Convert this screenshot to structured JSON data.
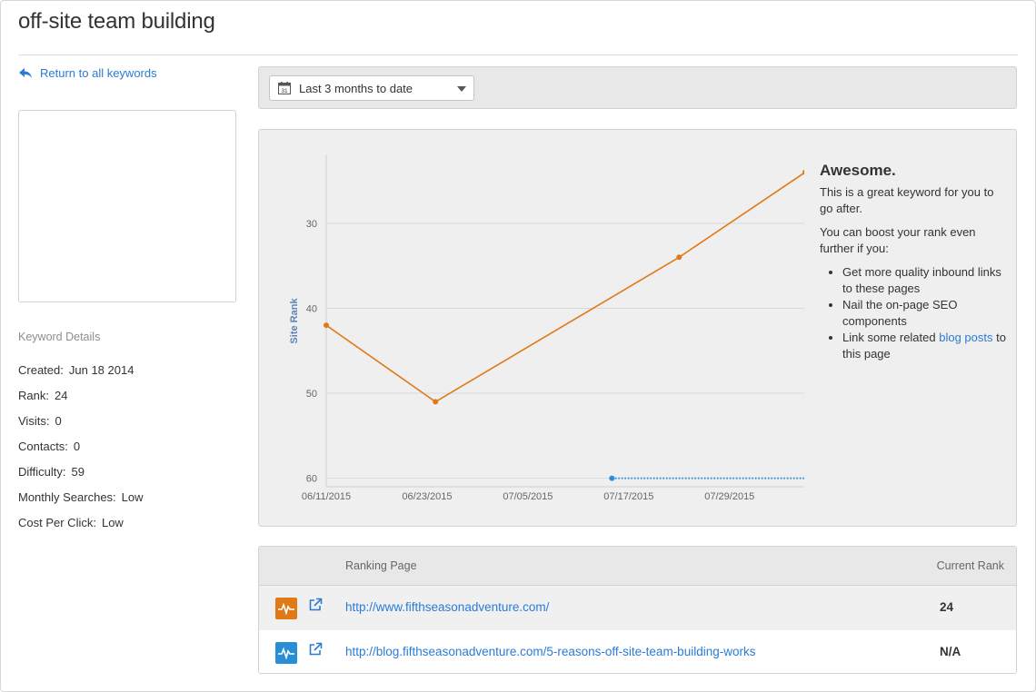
{
  "page": {
    "title": "off-site team building"
  },
  "sidebar": {
    "back_link": "Return to all keywords",
    "details_heading": "Keyword Details",
    "details": [
      {
        "label": "Created:",
        "value": "Jun 18 2014"
      },
      {
        "label": "Rank:",
        "value": "24"
      },
      {
        "label": "Visits:",
        "value": "0"
      },
      {
        "label": "Contacts:",
        "value": "0"
      },
      {
        "label": "Difficulty:",
        "value": "59"
      },
      {
        "label": "Monthly Searches:",
        "value": "Low"
      },
      {
        "label": "Cost Per Click:",
        "value": "Low"
      }
    ]
  },
  "toolbar": {
    "date_range": "Last 3 months to date",
    "calendar_icon": "calendar-icon",
    "calendar_day": "31"
  },
  "advice": {
    "heading": "Awesome.",
    "line1": "This is a great keyword for you to go after.",
    "line2": "You can boost your rank even further if you:",
    "bullets": [
      "Get more quality inbound links to these pages",
      "Nail the on-page SEO components"
    ],
    "bullet3_prefix": "Link some related ",
    "bullet3_link": "blog posts",
    "bullet3_suffix": " to this page"
  },
  "table": {
    "col_page": "Ranking Page",
    "col_rank": "Current Rank",
    "rows": [
      {
        "url": "http://www.fifthseasonadventure.com/",
        "rank": "24",
        "badge_color": "#e07a17"
      },
      {
        "url": "http://blog.fifthseasonadventure.com/5-reasons-off-site-team-building-works",
        "rank": "N/A",
        "badge_color": "#2a8ed6"
      }
    ]
  },
  "chart_data": {
    "type": "line",
    "ylabel": "Site Rank",
    "y_reversed": true,
    "ylim": [
      22,
      61
    ],
    "yticks": [
      30,
      40,
      50,
      60
    ],
    "xlim": [
      "2015-06-11",
      "2015-08-07"
    ],
    "xtick_labels": [
      "06/11/2015",
      "06/23/2015",
      "07/05/2015",
      "07/17/2015",
      "07/29/2015"
    ],
    "series": [
      {
        "style": "solid",
        "color": "#e07a17",
        "points": [
          {
            "x": "2015-06-11",
            "y": 42
          },
          {
            "x": "2015-06-24",
            "y": 51
          },
          {
            "x": "2015-07-23",
            "y": 34
          },
          {
            "x": "2015-08-07",
            "y": 24
          }
        ]
      },
      {
        "style": "dotted",
        "color": "#2a8ed6",
        "points": [
          {
            "x": "2015-07-15",
            "y": 60
          },
          {
            "x": "2015-08-07",
            "y": 60
          }
        ]
      }
    ]
  }
}
